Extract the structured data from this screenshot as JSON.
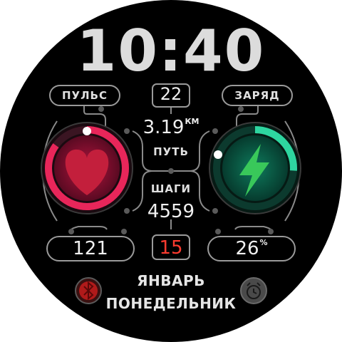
{
  "time": "10:40",
  "heart": {
    "label": "ПУЛЬС",
    "value": "121",
    "level": 0.85,
    "color": "#e8265a"
  },
  "battery": {
    "label": "ЗАРЯД",
    "value": "26",
    "unit": "%",
    "level": 0.26,
    "color": "#2ed6a0"
  },
  "day_number": "22",
  "distance": {
    "value": "3.19",
    "unit": "КМ",
    "label": "ПУТЬ"
  },
  "steps": {
    "label": "ШАГИ",
    "value": "4559"
  },
  "center_bottom_value": "15",
  "month": "ЯНВАРЬ",
  "weekday": "ПОНЕДЕЛЬНИК",
  "icons": {
    "left": "bluetooth-icon",
    "right": "alarm-clock-icon",
    "heart": "heart-icon",
    "battery": "lightning-icon"
  }
}
